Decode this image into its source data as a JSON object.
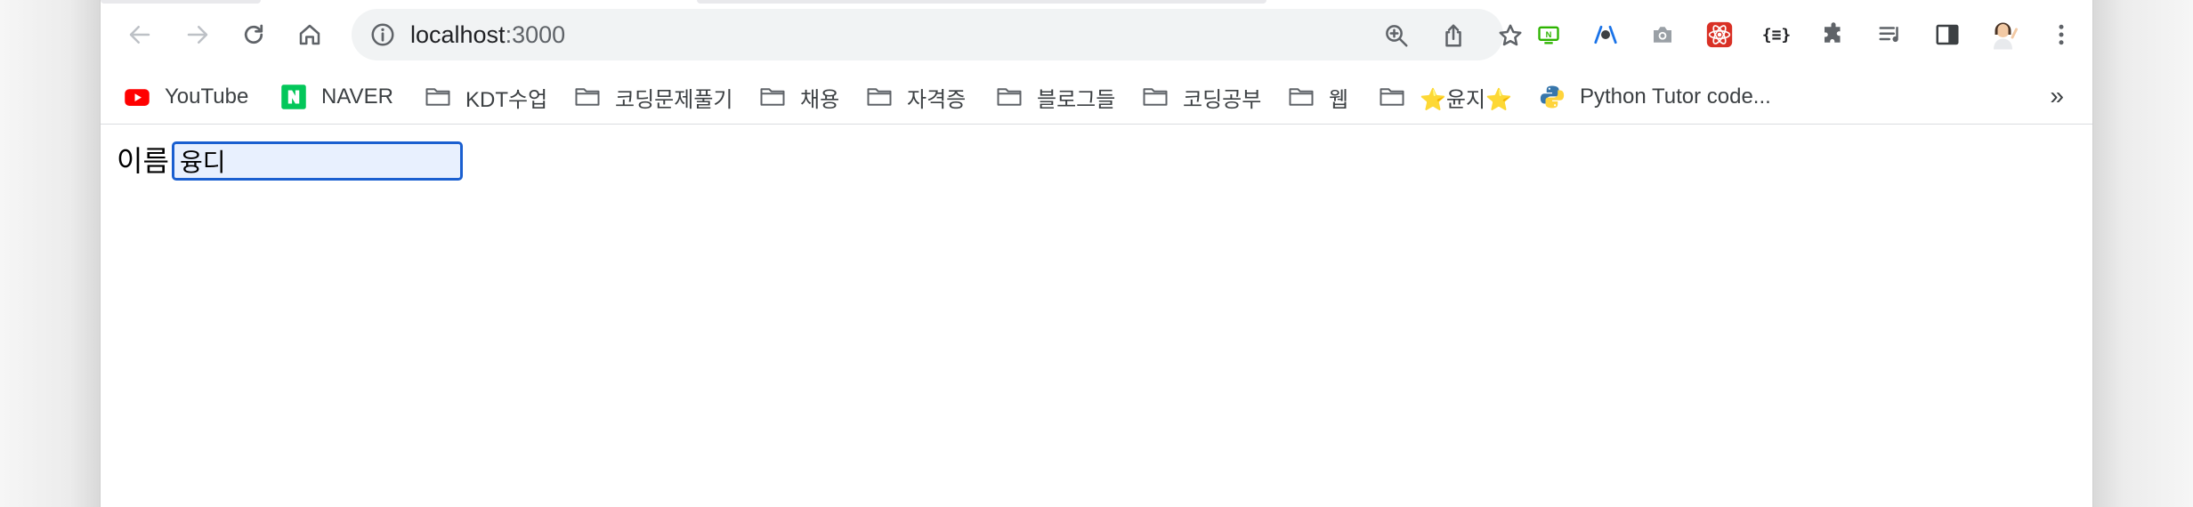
{
  "browser": {
    "url_host": "localhost",
    "url_port": ":3000",
    "bookmarks": [
      {
        "label": "YouTube",
        "icon": "youtube-icon"
      },
      {
        "label": "NAVER",
        "icon": "naver-icon"
      },
      {
        "label": "KDT수업",
        "icon": "folder-icon"
      },
      {
        "label": "코딩문제풀기",
        "icon": "folder-icon"
      },
      {
        "label": "채용",
        "icon": "folder-icon"
      },
      {
        "label": "자격증",
        "icon": "folder-icon"
      },
      {
        "label": "블로그들",
        "icon": "folder-icon"
      },
      {
        "label": "코딩공부",
        "icon": "folder-icon"
      },
      {
        "label": "웹",
        "icon": "folder-icon"
      },
      {
        "label": "⭐윤지⭐",
        "icon": "folder-icon"
      },
      {
        "label": "Python Tutor code...",
        "icon": "python-icon"
      }
    ],
    "bookmarks_overflow": "»",
    "extensions": [
      "naver-green-extension-icon",
      "devtools-extension-icon",
      "camera-extension-icon",
      "react-devtools-extension-icon",
      "json-extension-icon",
      "puzzle-extensions-icon",
      "media-queue-icon",
      "side-panel-icon",
      "profile-avatar-icon",
      "more-menu-icon"
    ]
  },
  "page": {
    "name_label": "이름",
    "name_value": "융디"
  },
  "colors": {
    "focus_border": "#1a5fd0",
    "autofill_bg": "#e8f0fe",
    "youtube_red": "#ff0000",
    "naver_green": "#03c75a"
  }
}
